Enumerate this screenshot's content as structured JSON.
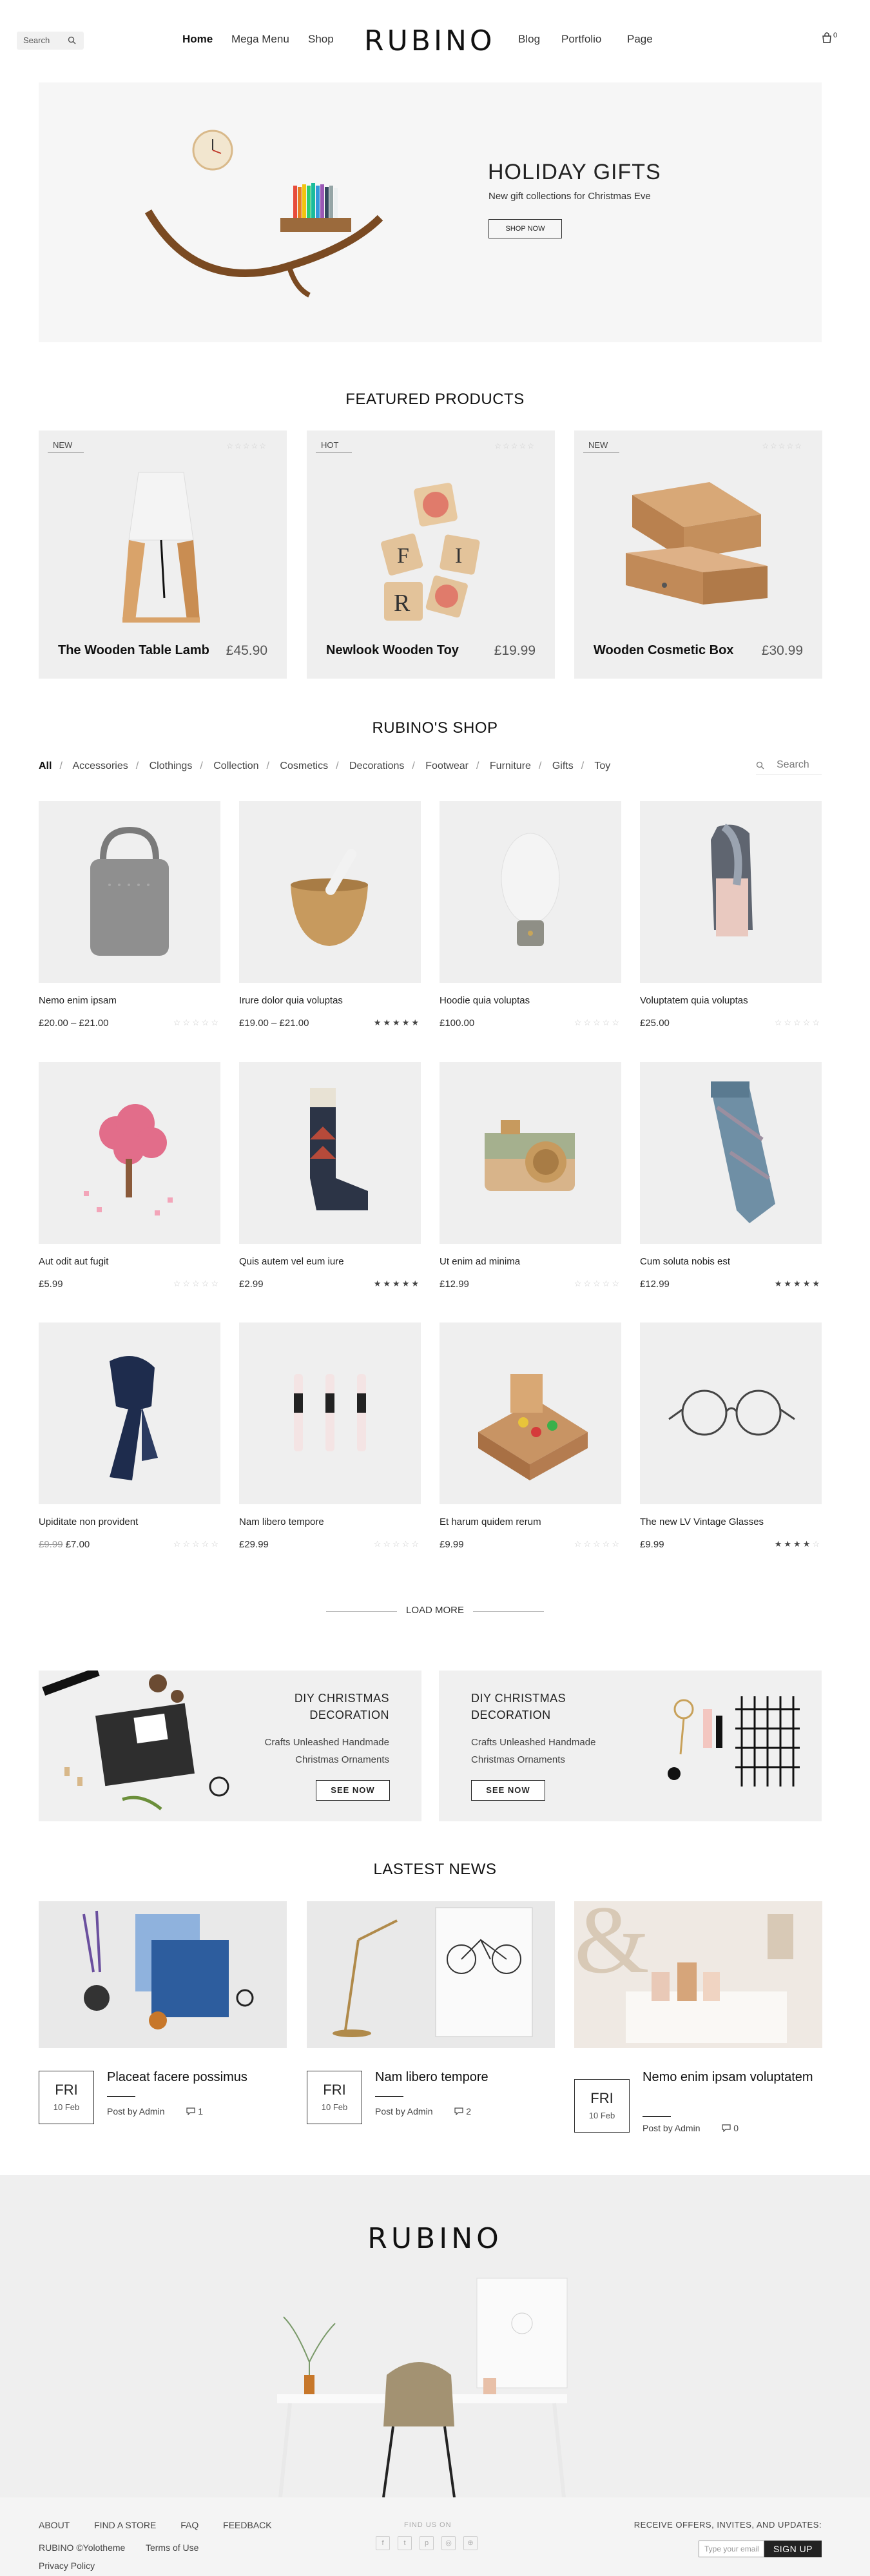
{
  "header": {
    "search_placeholder": "Search",
    "nav_left": [
      "Home",
      "Mega Menu",
      "Shop"
    ],
    "logo": "RUBINO",
    "nav_right": [
      "Blog",
      "Portfolio",
      "Page"
    ],
    "cart_count": "0"
  },
  "hero": {
    "title": "HOLIDAY GIFTS",
    "subtitle": "New gift collections for Christmas Eve",
    "button": "SHOP NOW"
  },
  "featured": {
    "title": "FEATURED PRODUCTS",
    "items": [
      {
        "badge": "NEW",
        "name": "The Wooden Table Lamb",
        "price": "£45.90",
        "stars": "☆☆☆☆☆"
      },
      {
        "badge": "HOT",
        "name": "Newlook Wooden Toy",
        "price": "£19.99",
        "stars": "☆☆☆☆☆"
      },
      {
        "badge": "NEW",
        "name": "Wooden Cosmetic Box",
        "price": "£30.99",
        "stars": "☆☆☆☆☆"
      }
    ]
  },
  "shop": {
    "title": "RUBINO'S SHOP",
    "filters": [
      "All",
      "Accessories",
      "Clothings",
      "Collection",
      "Cosmetics",
      "Decorations",
      "Footwear",
      "Furniture",
      "Gifts",
      "Toy"
    ],
    "search_placeholder": "Search",
    "products": [
      {
        "name": "Nemo enim ipsam",
        "price": "£20.00 – £21.00",
        "old": "",
        "rating": 0
      },
      {
        "name": "Irure dolor quia voluptas",
        "price": "£19.00 – £21.00",
        "old": "",
        "rating": 5
      },
      {
        "name": "Hoodie quia voluptas",
        "price": "£100.00",
        "old": "",
        "rating": 0
      },
      {
        "name": "Voluptatem quia voluptas",
        "price": "£25.00",
        "old": "",
        "rating": 0
      },
      {
        "name": "Aut odit aut fugit",
        "price": "£5.99",
        "old": "",
        "rating": 0
      },
      {
        "name": "Quis autem vel eum iure",
        "price": "£2.99",
        "old": "",
        "rating": 5
      },
      {
        "name": "Ut enim ad minima",
        "price": "£12.99",
        "old": "",
        "rating": 0
      },
      {
        "name": "Cum soluta nobis est",
        "price": "£12.99",
        "old": "",
        "rating": 5
      },
      {
        "name": "Upiditate non provident",
        "price": "£7.00",
        "old": "£9.99",
        "rating": 0
      },
      {
        "name": "Nam libero tempore",
        "price": "£29.99",
        "old": "",
        "rating": 0
      },
      {
        "name": "Et harum quidem rerum",
        "price": "£9.99",
        "old": "",
        "rating": 0
      },
      {
        "name": "The new LV Vintage Glasses",
        "price": "£9.99",
        "old": "",
        "rating": 4
      }
    ],
    "load_more": "LOAD MORE"
  },
  "promos": [
    {
      "title_1": "DIY CHRISTMAS",
      "title_2": "DECORATION",
      "line_1": "Crafts Unleashed Handmade",
      "line_2": "Christmas Ornaments",
      "button": "SEE NOW"
    },
    {
      "title_1": "DIY CHRISTMAS",
      "title_2": "DECORATION",
      "line_1": "Crafts Unleashed Handmade",
      "line_2": "Christmas Ornaments",
      "button": "SEE NOW"
    }
  ],
  "news": {
    "title": "LASTEST NEWS",
    "items": [
      {
        "day": "FRI",
        "date": "10 Feb",
        "title": "Placeat facere possimus",
        "author": "Post by Admin",
        "comments": "1"
      },
      {
        "day": "FRI",
        "date": "10 Feb",
        "title": "Nam libero tempore",
        "author": "Post by Admin",
        "comments": "2"
      },
      {
        "day": "FRI",
        "date": "10 Feb",
        "title": "Nemo enim ipsam voluptatem",
        "author": "Post by Admin",
        "comments": "0"
      }
    ]
  },
  "footer": {
    "logo": "RUBINO",
    "links": [
      "ABOUT",
      "FIND A STORE",
      "FAQ",
      "FEEDBACK"
    ],
    "copyright": "RUBINO ©Yolotheme",
    "terms": "Terms of Use",
    "policy": "Privacy Policy",
    "find_us": "FIND US ON",
    "offers": "RECEIVE OFFERS, INVITES, AND UPDATES:",
    "email_placeholder": "Type your email",
    "signup": "SIGN UP"
  }
}
